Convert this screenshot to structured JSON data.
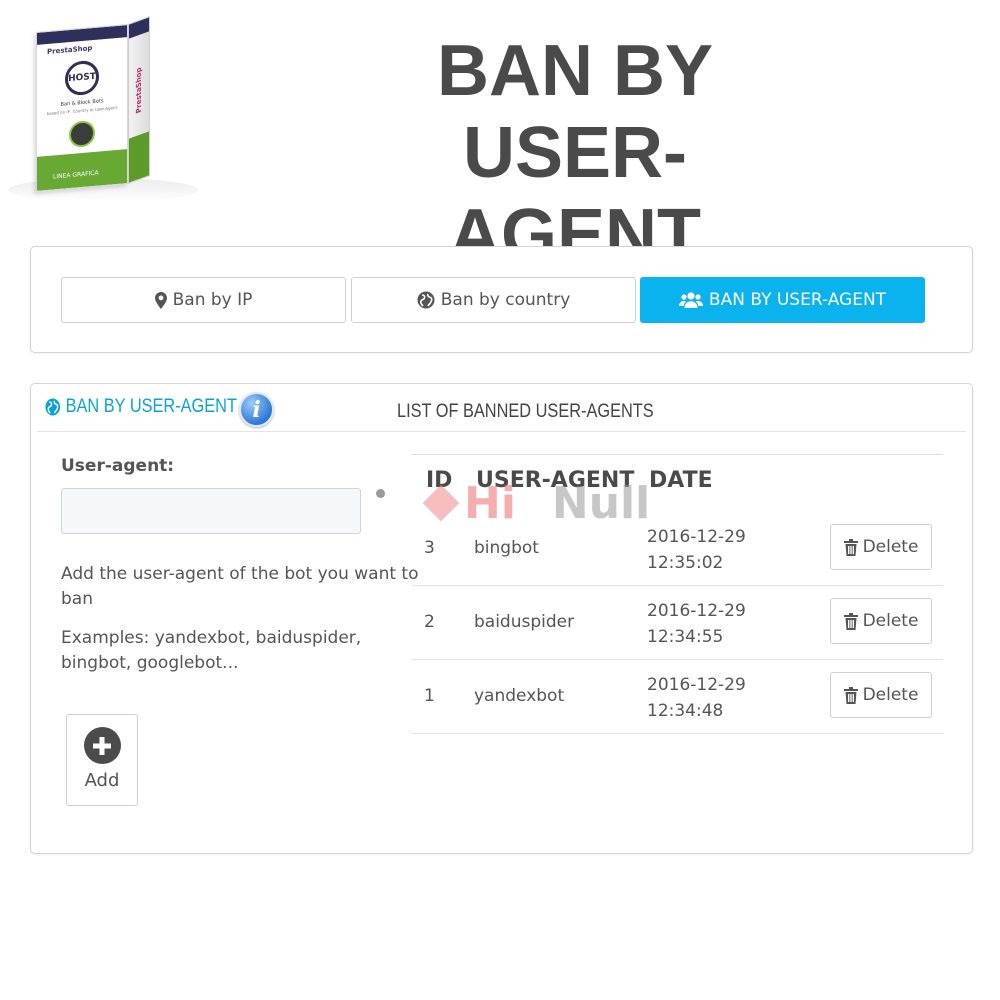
{
  "product_box": {
    "brand": "PrestaShop",
    "logo_text": "HOST",
    "title": "Ban & Block Bots",
    "subtitle": "based on IP, Country or User-Agent",
    "footer": "LINEA GRAFICA",
    "side_text": "PrestaShop"
  },
  "page_title": {
    "line1": "BAN BY",
    "line2": "USER-AGENT"
  },
  "tabs": [
    {
      "label": "Ban by IP",
      "icon": "map-marker-icon",
      "active": false
    },
    {
      "label": "Ban by country",
      "icon": "globe-icon",
      "active": false
    },
    {
      "label": "BAN BY USER-AGENT",
      "icon": "users-icon",
      "active": true
    }
  ],
  "panel": {
    "left_title": "BAN BY USER-AGENT",
    "info_icon": "info-icon",
    "right_title": "LIST OF BANNED USER-AGENTS"
  },
  "form": {
    "label": "User-agent:",
    "value": "",
    "placeholder": "",
    "help": "Add the user-agent of the bot you want to ban",
    "examples": "Examples: yandexbot, baiduspider, bingbot, googlebot...",
    "add_label": "Add"
  },
  "table": {
    "columns": [
      "ID",
      "USER-AGENT",
      "DATE"
    ],
    "delete_label": "Delete",
    "rows": [
      {
        "id": "3",
        "agent": "bingbot",
        "date": "2016-12-29",
        "time": "12:35:02"
      },
      {
        "id": "2",
        "agent": "baiduspider",
        "date": "2016-12-29",
        "time": "12:34:55"
      },
      {
        "id": "1",
        "agent": "yandexbot",
        "date": "2016-12-29",
        "time": "12:34:48"
      }
    ]
  },
  "watermark": {
    "part1": "Hi",
    "part2": "Null"
  },
  "colors": {
    "accent": "#0bb3ee",
    "title": "#4a4a4a",
    "panel_heading": "#0aa4d8",
    "text": "#555555"
  }
}
